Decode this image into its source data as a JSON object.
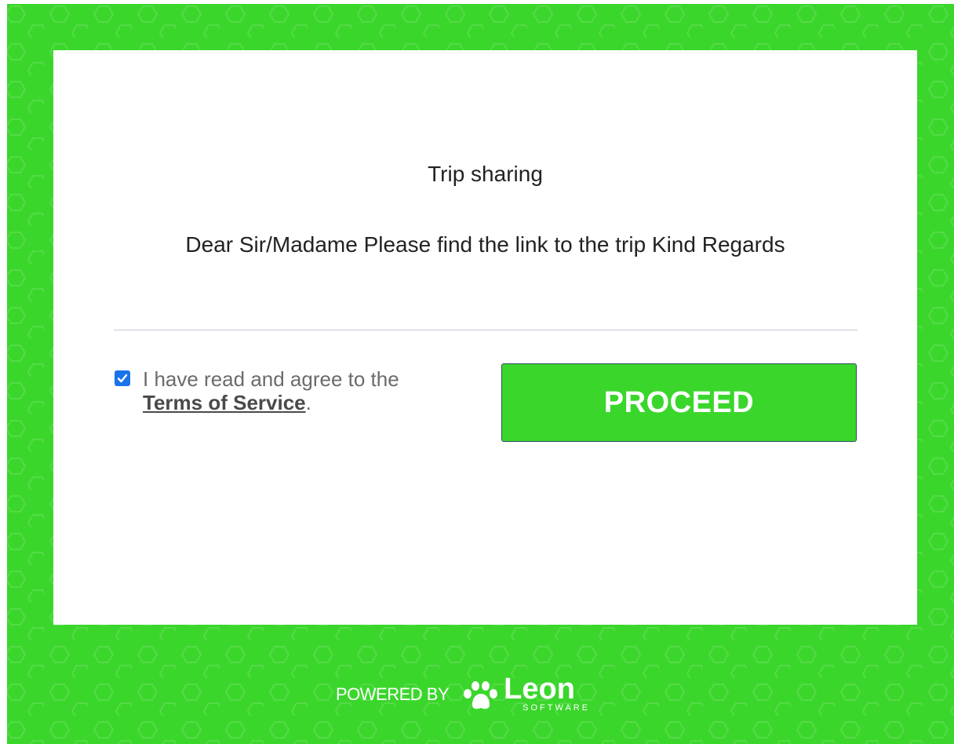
{
  "card": {
    "title": "Trip sharing",
    "message": "Dear Sir/Madame Please find the link to the trip Kind Regards"
  },
  "terms": {
    "checked": true,
    "text_before": "I have read and agree to the",
    "link_text": "Terms of Service",
    "text_after": "."
  },
  "proceed_button": {
    "label": "PROCEED"
  },
  "footer": {
    "powered_by": "POWERED BY",
    "brand_name": "Leon",
    "brand_sub": "SOFTWARE"
  },
  "colors": {
    "brand_green": "#3bd62c",
    "checkbox_blue": "#1a73e8",
    "card_bg": "#ffffff"
  },
  "icons": {
    "paw": "paw-icon",
    "checkmark": "checkmark-icon"
  }
}
